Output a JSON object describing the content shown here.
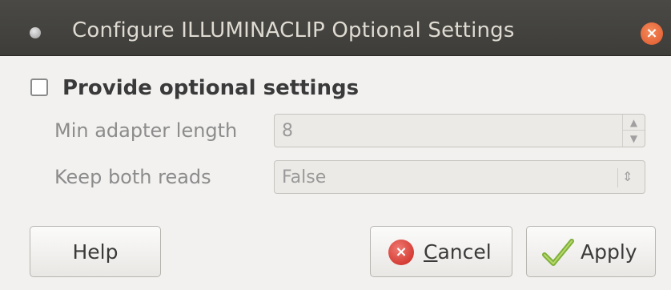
{
  "window": {
    "title": "Configure ILLUMINACLIP Optional Settings"
  },
  "option": {
    "checkbox_label": "Provide optional settings",
    "checked": false
  },
  "fields": {
    "min_adapter_label": "Min adapter length",
    "min_adapter_value": "8",
    "keep_reads_label": "Keep both reads",
    "keep_reads_value": "False"
  },
  "buttons": {
    "help": "Help",
    "cancel_mnemonic": "C",
    "cancel_rest": "ancel",
    "apply": "Apply"
  },
  "icons": {
    "window": "window-dot-icon",
    "close": "close-icon",
    "cancel": "cancel-icon",
    "apply": "check-icon"
  }
}
